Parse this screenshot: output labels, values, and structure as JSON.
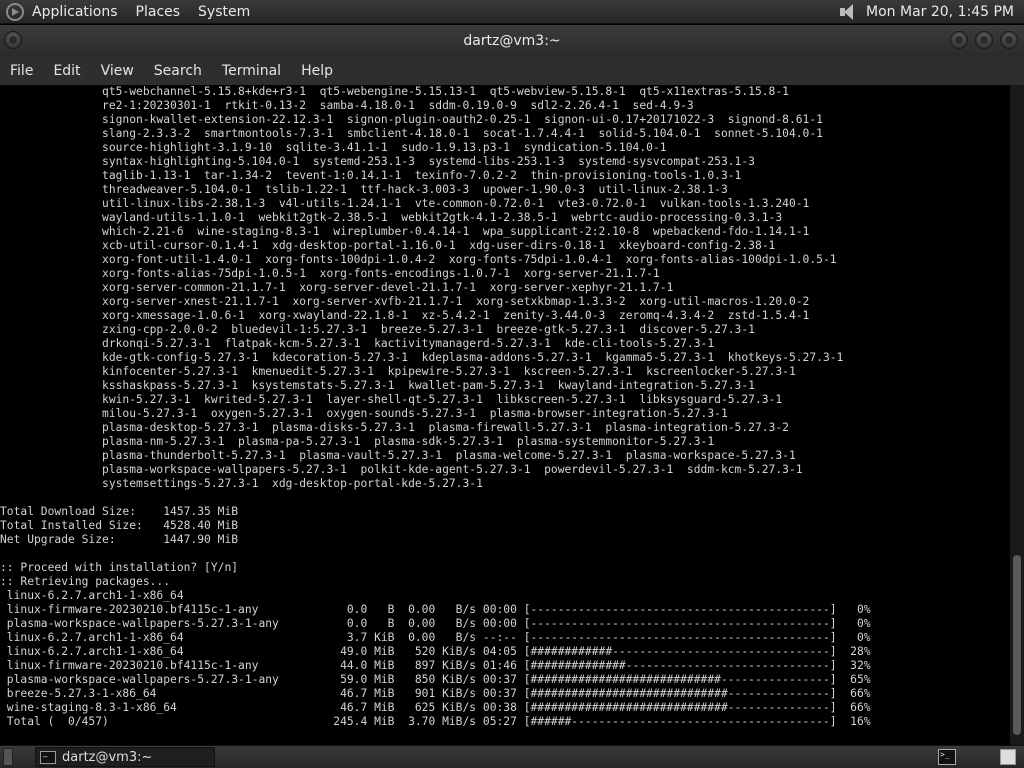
{
  "top_panel": {
    "menus": [
      "Applications",
      "Places",
      "System"
    ],
    "clock": "Mon Mar 20,  1:45 PM",
    "icons": {
      "logo": "mint-logo-icon",
      "volume": "speaker-icon"
    }
  },
  "window": {
    "title": "dartz@vm3:~",
    "menus": [
      "File",
      "Edit",
      "View",
      "Search",
      "Terminal",
      "Help"
    ]
  },
  "terminal": {
    "lines": [
      "               qt5-webchannel-5.15.8+kde+r3-1  qt5-webengine-5.15.13-1  qt5-webview-5.15.8-1  qt5-x11extras-5.15.8-1",
      "               re2-1:20230301-1  rtkit-0.13-2  samba-4.18.0-1  sddm-0.19.0-9  sdl2-2.26.4-1  sed-4.9-3",
      "               signon-kwallet-extension-22.12.3-1  signon-plugin-oauth2-0.25-1  signon-ui-0.17+20171022-3  signond-8.61-1",
      "               slang-2.3.3-2  smartmontools-7.3-1  smbclient-4.18.0-1  socat-1.7.4.4-1  solid-5.104.0-1  sonnet-5.104.0-1",
      "               source-highlight-3.1.9-10  sqlite-3.41.1-1  sudo-1.9.13.p3-1  syndication-5.104.0-1",
      "               syntax-highlighting-5.104.0-1  systemd-253.1-3  systemd-libs-253.1-3  systemd-sysvcompat-253.1-3",
      "               taglib-1.13-1  tar-1.34-2  tevent-1:0.14.1-1  texinfo-7.0.2-2  thin-provisioning-tools-1.0.3-1",
      "               threadweaver-5.104.0-1  tslib-1.22-1  ttf-hack-3.003-3  upower-1.90.0-3  util-linux-2.38.1-3",
      "               util-linux-libs-2.38.1-3  v4l-utils-1.24.1-1  vte-common-0.72.0-1  vte3-0.72.0-1  vulkan-tools-1.3.240-1",
      "               wayland-utils-1.1.0-1  webkit2gtk-2.38.5-1  webkit2gtk-4.1-2.38.5-1  webrtc-audio-processing-0.3.1-3",
      "               which-2.21-6  wine-staging-8.3-1  wireplumber-0.4.14-1  wpa_supplicant-2:2.10-8  wpebackend-fdo-1.14.1-1",
      "               xcb-util-cursor-0.1.4-1  xdg-desktop-portal-1.16.0-1  xdg-user-dirs-0.18-1  xkeyboard-config-2.38-1",
      "               xorg-font-util-1.4.0-1  xorg-fonts-100dpi-1.0.4-2  xorg-fonts-75dpi-1.0.4-1  xorg-fonts-alias-100dpi-1.0.5-1",
      "               xorg-fonts-alias-75dpi-1.0.5-1  xorg-fonts-encodings-1.0.7-1  xorg-server-21.1.7-1",
      "               xorg-server-common-21.1.7-1  xorg-server-devel-21.1.7-1  xorg-server-xephyr-21.1.7-1",
      "               xorg-server-xnest-21.1.7-1  xorg-server-xvfb-21.1.7-1  xorg-setxkbmap-1.3.3-2  xorg-util-macros-1.20.0-2",
      "               xorg-xmessage-1.0.6-1  xorg-xwayland-22.1.8-1  xz-5.4.2-1  zenity-3.44.0-3  zeromq-4.3.4-2  zstd-1.5.4-1",
      "               zxing-cpp-2.0.0-2  bluedevil-1:5.27.3-1  breeze-5.27.3-1  breeze-gtk-5.27.3-1  discover-5.27.3-1",
      "               drkonqi-5.27.3-1  flatpak-kcm-5.27.3-1  kactivitymanagerd-5.27.3-1  kde-cli-tools-5.27.3-1",
      "               kde-gtk-config-5.27.3-1  kdecoration-5.27.3-1  kdeplasma-addons-5.27.3-1  kgamma5-5.27.3-1  khotkeys-5.27.3-1",
      "               kinfocenter-5.27.3-1  kmenuedit-5.27.3-1  kpipewire-5.27.3-1  kscreen-5.27.3-1  kscreenlocker-5.27.3-1",
      "               ksshaskpass-5.27.3-1  ksystemstats-5.27.3-1  kwallet-pam-5.27.3-1  kwayland-integration-5.27.3-1",
      "               kwin-5.27.3-1  kwrited-5.27.3-1  layer-shell-qt-5.27.3-1  libkscreen-5.27.3-1  libksysguard-5.27.3-1",
      "               milou-5.27.3-1  oxygen-5.27.3-1  oxygen-sounds-5.27.3-1  plasma-browser-integration-5.27.3-1",
      "               plasma-desktop-5.27.3-1  plasma-disks-5.27.3-1  plasma-firewall-5.27.3-1  plasma-integration-5.27.3-2",
      "               plasma-nm-5.27.3-1  plasma-pa-5.27.3-1  plasma-sdk-5.27.3-1  plasma-systemmonitor-5.27.3-1",
      "               plasma-thunderbolt-5.27.3-1  plasma-vault-5.27.3-1  plasma-welcome-5.27.3-1  plasma-workspace-5.27.3-1",
      "               plasma-workspace-wallpapers-5.27.3-1  polkit-kde-agent-5.27.3-1  powerdevil-5.27.3-1  sddm-kcm-5.27.3-1",
      "               systemsettings-5.27.3-1  xdg-desktop-portal-kde-5.27.3-1",
      "",
      "Total Download Size:    1457.35 MiB",
      "Total Installed Size:   4528.40 MiB",
      "Net Upgrade Size:       1447.90 MiB",
      "",
      ":: Proceed with installation? [Y/n]",
      ":: Retrieving packages...",
      " linux-6.2.7.arch1-1-x86_64",
      " linux-firmware-20230210.bf4115c-1-any             0.0   B  0.00   B/s 00:00 [--------------------------------------------]   0%",
      " plasma-workspace-wallpapers-5.27.3-1-any          0.0   B  0.00   B/s 00:00 [--------------------------------------------]   0%",
      " linux-6.2.7.arch1-1-x86_64                        3.7 KiB  0.00   B/s --:-- [--------------------------------------------]   0%",
      " linux-6.2.7.arch1-1-x86_64                       49.0 MiB   520 KiB/s 04:05 [############--------------------------------]  28%",
      " linux-firmware-20230210.bf4115c-1-any            44.0 MiB   897 KiB/s 01:46 [##############------------------------------]  32%",
      " plasma-workspace-wallpapers-5.27.3-1-any         59.0 MiB   850 KiB/s 00:37 [############################----------------]  65%",
      " breeze-5.27.3-1-x86_64                           46.7 MiB   901 KiB/s 00:37 [#############################---------------]  66%",
      " wine-staging-8.3-1-x86_64                        46.7 MiB   625 KiB/s 00:38 [#############################---------------]  66%",
      " Total (  0/457)                                 245.4 MiB  3.70 MiB/s 05:27 [######--------------------------------------]  16%"
    ]
  },
  "taskbar": {
    "task_label": "dartz@vm3:~",
    "icons": {
      "show_desktop": "show-desktop-icon",
      "task": "terminal-icon",
      "tray": "terminal-tray-icon"
    }
  }
}
